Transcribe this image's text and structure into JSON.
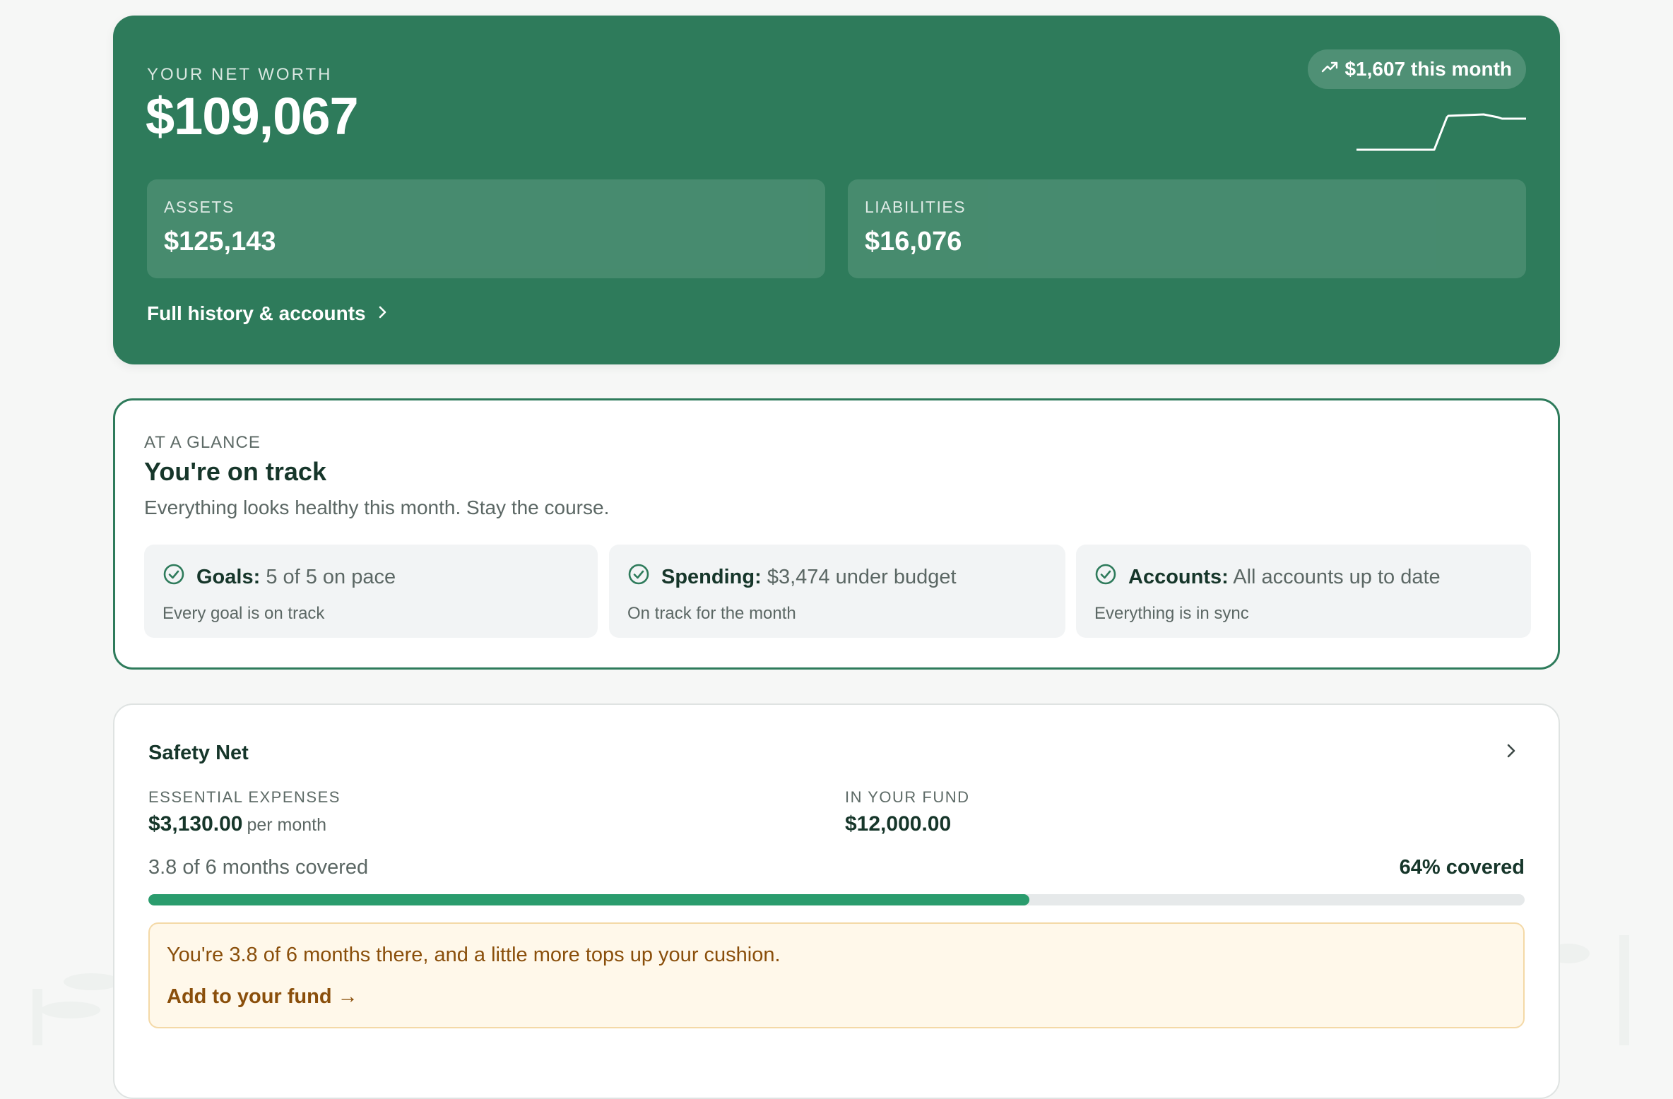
{
  "net_worth": {
    "eyebrow": "YOUR NET WORTH",
    "amount": "$109,067",
    "change": "$1,607 this month",
    "assets": {
      "label": "ASSETS",
      "value": "$125,143"
    },
    "liabilities": {
      "label": "LIABILITIES",
      "value": "$16,076"
    },
    "link": "Full history & accounts",
    "colors": {
      "background": "#2e7b5b",
      "text": "#ffffff"
    },
    "icons": {
      "trend": "trending-up-icon",
      "chevron": "chevron-right-icon"
    }
  },
  "glance": {
    "eyebrow": "AT A GLANCE",
    "title": "You're on track",
    "subtitle": "Everything looks healthy this month. Stay the course.",
    "items": [
      {
        "label": "Goals:",
        "value": "5 of 5 on pace",
        "note": "Every goal is on track"
      },
      {
        "label": "Spending:",
        "value": "$3,474 under budget",
        "note": "On track for the month"
      },
      {
        "label": "Accounts:",
        "value": "All accounts up to date",
        "note": "Everything is in sync"
      }
    ],
    "colors": {
      "border": "#2e7b5b",
      "check": "#2e7b5b"
    }
  },
  "safety_net": {
    "title": "Safety Net",
    "essential_label": "ESSENTIAL EXPENSES",
    "essential_value": "$3,130.00",
    "essential_unit": "per month",
    "fund_label": "IN YOUR FUND",
    "fund_value": "$12,000.00",
    "coverage_text": "3.8 of 6 months covered",
    "coverage_percent_text": "64% covered",
    "progress": 0.64,
    "alert_message": "You're 3.8 of 6 months there, and a little more tops up your cushion.",
    "alert_cta": "Add to your fund →",
    "colors": {
      "progress": "#2a9c6d",
      "alert_bg": "#fff8ea",
      "alert_text": "#8a4f0b"
    }
  }
}
